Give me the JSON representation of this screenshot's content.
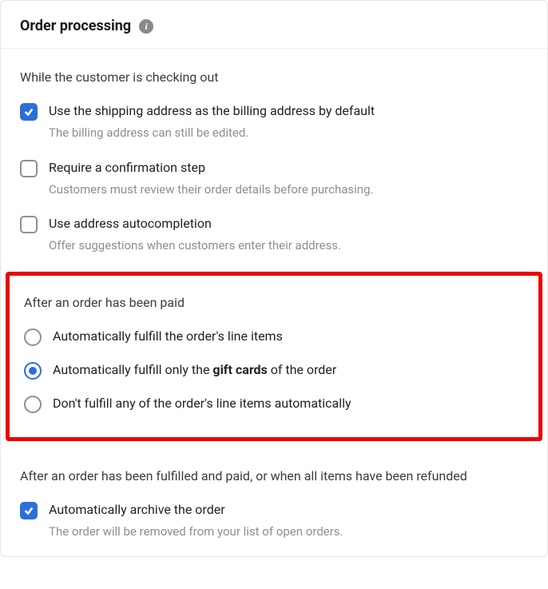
{
  "header": {
    "title": "Order processing"
  },
  "sections": {
    "checkout": {
      "title": "While the customer is checking out",
      "options": {
        "billing": {
          "label": "Use the shipping address as the billing address by default",
          "sub": "The billing address can still be edited."
        },
        "confirm": {
          "label": "Require a confirmation step",
          "sub": "Customers must review their order details before purchasing."
        },
        "autocomplete": {
          "label": "Use address autocompletion",
          "sub": "Offer suggestions when customers enter their address."
        }
      }
    },
    "paid": {
      "title": "After an order has been paid",
      "options": {
        "fulfill_all": {
          "label": "Automatically fulfill the order's line items"
        },
        "fulfill_gift_pre": "Automatically fulfill only the ",
        "fulfill_gift_bold": "gift cards",
        "fulfill_gift_post": " of the order",
        "fulfill_none": {
          "label": "Don't fulfill any of the order's line items automatically"
        }
      }
    },
    "archive": {
      "title": "After an order has been fulfilled and paid, or when all items have been refunded",
      "options": {
        "archive": {
          "label": "Automatically archive the order",
          "sub": "The order will be removed from your list of open orders."
        }
      }
    }
  }
}
